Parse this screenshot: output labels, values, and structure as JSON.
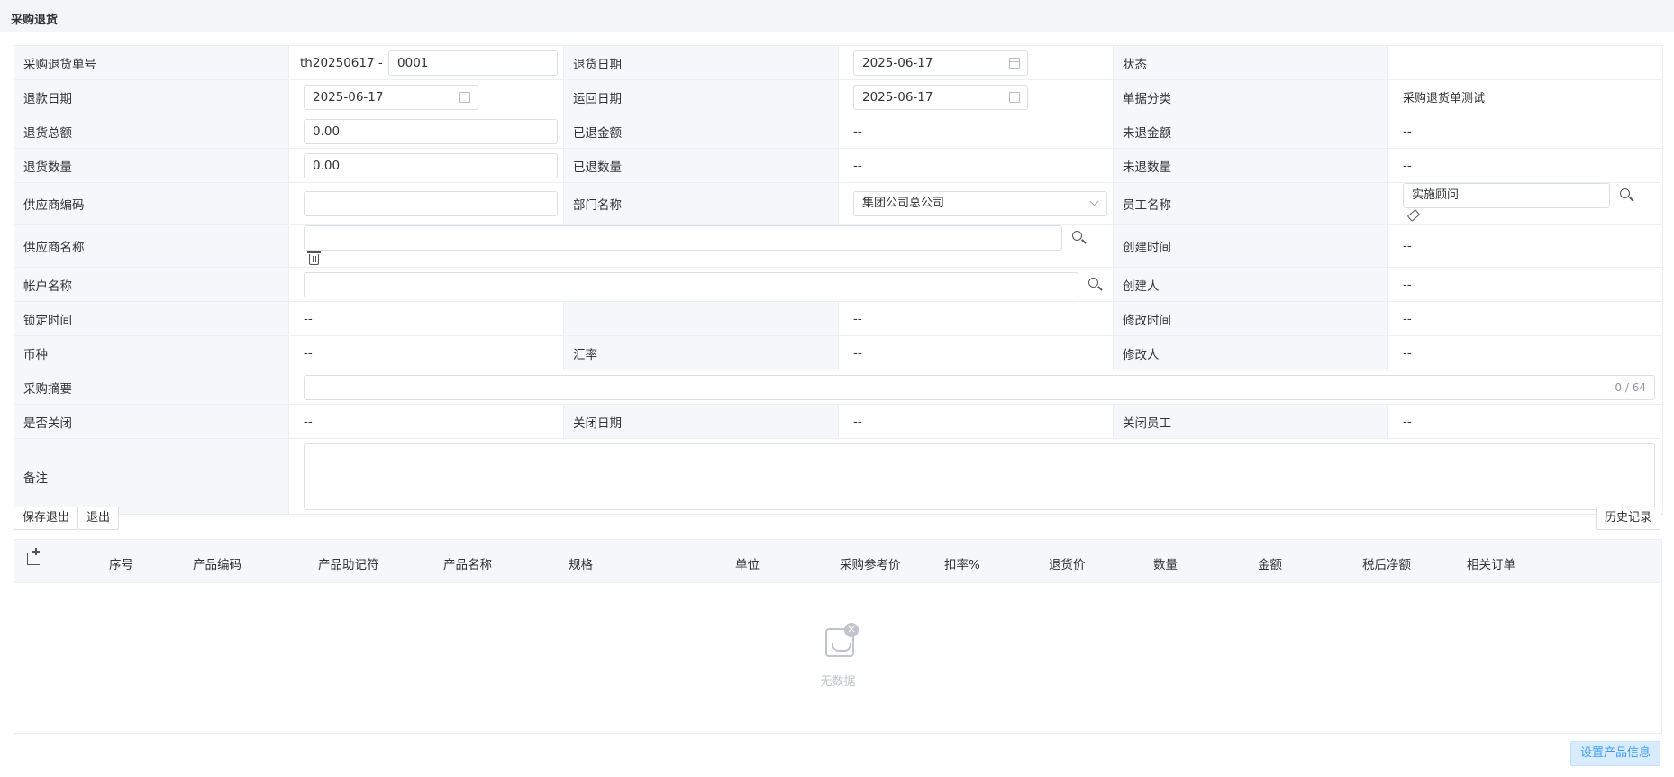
{
  "page_title": "采购退货",
  "form": {
    "return_no": {
      "label": "采购退货单号",
      "prefix": "th20250617 -",
      "value": "0001"
    },
    "return_date": {
      "label": "退货日期",
      "value": "2025-06-17"
    },
    "status": {
      "label": "状态",
      "value": ""
    },
    "refund_date": {
      "label": "退款日期",
      "value": "2025-06-17"
    },
    "ship_back_date": {
      "label": "运回日期",
      "value": "2025-06-17"
    },
    "doc_category": {
      "label": "单据分类",
      "value": "采购退货单测试"
    },
    "return_total": {
      "label": "退货总额",
      "value": "0.00"
    },
    "refunded_amount": {
      "label": "已退金额",
      "value": "--"
    },
    "unrefunded_amount": {
      "label": "未退金额",
      "value": "--"
    },
    "return_qty": {
      "label": "退货数量",
      "value": "0.00"
    },
    "returned_qty": {
      "label": "已退数量",
      "value": "--"
    },
    "unreturned_qty": {
      "label": "未退数量",
      "value": "--"
    },
    "supplier_code": {
      "label": "供应商编码",
      "value": ""
    },
    "dept_name": {
      "label": "部门名称",
      "value": "集团公司总公司"
    },
    "employee_name": {
      "label": "员工名称",
      "value": "实施顾问"
    },
    "supplier_name": {
      "label": "供应商名称",
      "value": ""
    },
    "created_time": {
      "label": "创建时间",
      "value": "--"
    },
    "account_name": {
      "label": "帐户名称",
      "value": ""
    },
    "creator": {
      "label": "创建人",
      "value": "--"
    },
    "lock_time": {
      "label": "锁定时间",
      "value": "--"
    },
    "blank_value": "--",
    "modified_time": {
      "label": "修改时间",
      "value": "--"
    },
    "currency": {
      "label": "币种",
      "value": "--"
    },
    "exchange_rate": {
      "label": "汇率",
      "value": "--"
    },
    "modifier": {
      "label": "修改人",
      "value": "--"
    },
    "summary": {
      "label": "采购摘要",
      "value": "",
      "counter": "0 / 64"
    },
    "closed": {
      "label": "是否关闭",
      "value": "--"
    },
    "close_date": {
      "label": "关闭日期",
      "value": "--"
    },
    "close_employee": {
      "label": "关闭员工",
      "value": "--"
    },
    "remark": {
      "label": "备注",
      "value": ""
    }
  },
  "actions": {
    "save_exit": "保存退出",
    "exit": "退出",
    "history": "历史记录",
    "set_product_info": "设置产品信息"
  },
  "grid": {
    "columns": [
      "序号",
      "产品编码",
      "产品助记符",
      "产品名称",
      "规格",
      "单位",
      "采购参考价",
      "扣率%",
      "退货价",
      "数量",
      "金额",
      "税后净额",
      "相关订单"
    ],
    "rows": [],
    "empty_text": "无数据"
  },
  "icons": {
    "date": "calendar-icon",
    "search": "search-icon",
    "delete": "trash-icon",
    "clear": "eraser-icon",
    "add_column": "add-column-icon",
    "empty": "empty-inbox-icon"
  }
}
